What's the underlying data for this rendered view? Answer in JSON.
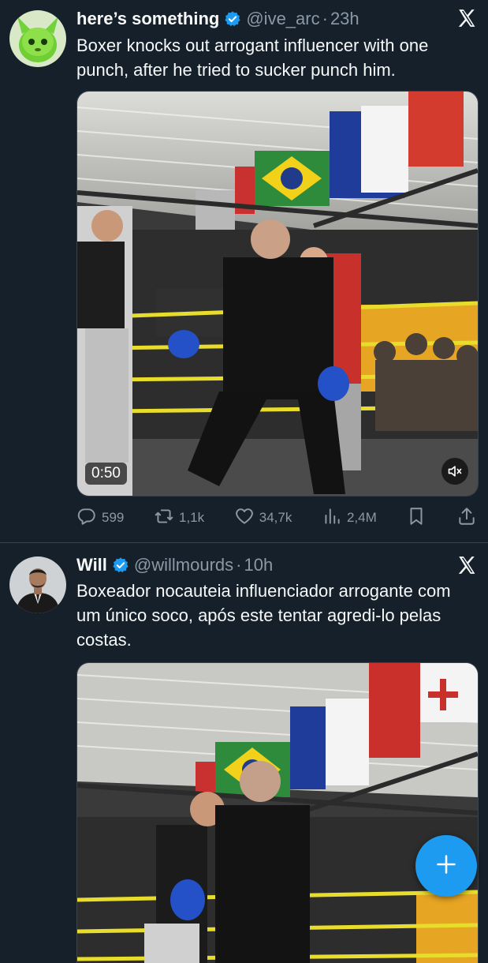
{
  "tweets": [
    {
      "display_name": "here’s something",
      "handle": "@ive_arc",
      "separator": "·",
      "time": "23h",
      "text": "Boxer knocks out arrogant influencer with one punch, after he tried to sucker punch him.",
      "video_duration": "0:50",
      "stats": {
        "replies": "599",
        "reposts": "1,1k",
        "likes": "34,7k",
        "views": "2,4M"
      }
    },
    {
      "display_name": "Will",
      "handle": "@willmourds",
      "separator": "·",
      "time": "10h",
      "text": "Boxeador nocauteia influenciador arrogante com um único soco, após este tentar agredi-lo pelas costas."
    }
  ],
  "colors": {
    "background": "#15202b",
    "accent": "#1d9bf0",
    "muted": "#8b98a5",
    "divider": "#38444d"
  },
  "icons": [
    "verified-badge-icon",
    "x-logo-icon",
    "reply-icon",
    "repost-icon",
    "like-icon",
    "views-icon",
    "bookmark-icon",
    "share-icon",
    "mute-icon",
    "plus-icon"
  ]
}
